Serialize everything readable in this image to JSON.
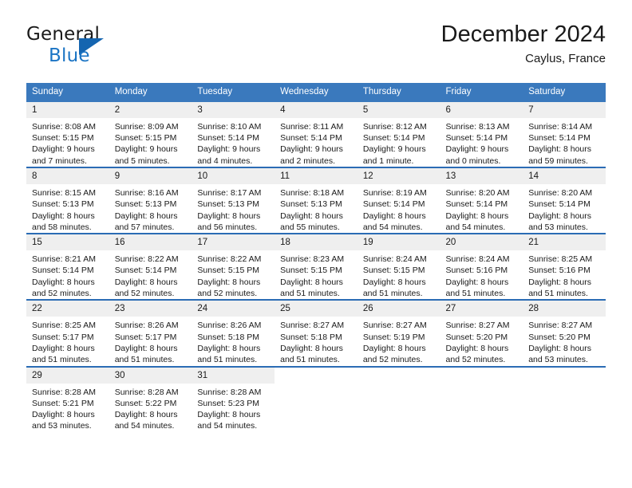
{
  "brand": {
    "name_part1": "General",
    "name_part2": "Blue",
    "triangle_color": "#1565b0",
    "blue_text_color": "#1b74c4"
  },
  "header": {
    "title": "December 2024",
    "subtitle": "Caylus, France"
  },
  "theme": {
    "header_bg": "#3a79bd",
    "row_divider": "#2b6cb5",
    "daynum_bg": "#efefef",
    "text": "#1a1a1a"
  },
  "weekdays": [
    "Sunday",
    "Monday",
    "Tuesday",
    "Wednesday",
    "Thursday",
    "Friday",
    "Saturday"
  ],
  "weeks": [
    [
      {
        "day": "1",
        "sunrise": "Sunrise: 8:08 AM",
        "sunset": "Sunset: 5:15 PM",
        "daylight_line1": "Daylight: 9 hours",
        "daylight_line2": "and 7 minutes."
      },
      {
        "day": "2",
        "sunrise": "Sunrise: 8:09 AM",
        "sunset": "Sunset: 5:15 PM",
        "daylight_line1": "Daylight: 9 hours",
        "daylight_line2": "and 5 minutes."
      },
      {
        "day": "3",
        "sunrise": "Sunrise: 8:10 AM",
        "sunset": "Sunset: 5:14 PM",
        "daylight_line1": "Daylight: 9 hours",
        "daylight_line2": "and 4 minutes."
      },
      {
        "day": "4",
        "sunrise": "Sunrise: 8:11 AM",
        "sunset": "Sunset: 5:14 PM",
        "daylight_line1": "Daylight: 9 hours",
        "daylight_line2": "and 2 minutes."
      },
      {
        "day": "5",
        "sunrise": "Sunrise: 8:12 AM",
        "sunset": "Sunset: 5:14 PM",
        "daylight_line1": "Daylight: 9 hours",
        "daylight_line2": "and 1 minute."
      },
      {
        "day": "6",
        "sunrise": "Sunrise: 8:13 AM",
        "sunset": "Sunset: 5:14 PM",
        "daylight_line1": "Daylight: 9 hours",
        "daylight_line2": "and 0 minutes."
      },
      {
        "day": "7",
        "sunrise": "Sunrise: 8:14 AM",
        "sunset": "Sunset: 5:14 PM",
        "daylight_line1": "Daylight: 8 hours",
        "daylight_line2": "and 59 minutes."
      }
    ],
    [
      {
        "day": "8",
        "sunrise": "Sunrise: 8:15 AM",
        "sunset": "Sunset: 5:13 PM",
        "daylight_line1": "Daylight: 8 hours",
        "daylight_line2": "and 58 minutes."
      },
      {
        "day": "9",
        "sunrise": "Sunrise: 8:16 AM",
        "sunset": "Sunset: 5:13 PM",
        "daylight_line1": "Daylight: 8 hours",
        "daylight_line2": "and 57 minutes."
      },
      {
        "day": "10",
        "sunrise": "Sunrise: 8:17 AM",
        "sunset": "Sunset: 5:13 PM",
        "daylight_line1": "Daylight: 8 hours",
        "daylight_line2": "and 56 minutes."
      },
      {
        "day": "11",
        "sunrise": "Sunrise: 8:18 AM",
        "sunset": "Sunset: 5:13 PM",
        "daylight_line1": "Daylight: 8 hours",
        "daylight_line2": "and 55 minutes."
      },
      {
        "day": "12",
        "sunrise": "Sunrise: 8:19 AM",
        "sunset": "Sunset: 5:14 PM",
        "daylight_line1": "Daylight: 8 hours",
        "daylight_line2": "and 54 minutes."
      },
      {
        "day": "13",
        "sunrise": "Sunrise: 8:20 AM",
        "sunset": "Sunset: 5:14 PM",
        "daylight_line1": "Daylight: 8 hours",
        "daylight_line2": "and 54 minutes."
      },
      {
        "day": "14",
        "sunrise": "Sunrise: 8:20 AM",
        "sunset": "Sunset: 5:14 PM",
        "daylight_line1": "Daylight: 8 hours",
        "daylight_line2": "and 53 minutes."
      }
    ],
    [
      {
        "day": "15",
        "sunrise": "Sunrise: 8:21 AM",
        "sunset": "Sunset: 5:14 PM",
        "daylight_line1": "Daylight: 8 hours",
        "daylight_line2": "and 52 minutes."
      },
      {
        "day": "16",
        "sunrise": "Sunrise: 8:22 AM",
        "sunset": "Sunset: 5:14 PM",
        "daylight_line1": "Daylight: 8 hours",
        "daylight_line2": "and 52 minutes."
      },
      {
        "day": "17",
        "sunrise": "Sunrise: 8:22 AM",
        "sunset": "Sunset: 5:15 PM",
        "daylight_line1": "Daylight: 8 hours",
        "daylight_line2": "and 52 minutes."
      },
      {
        "day": "18",
        "sunrise": "Sunrise: 8:23 AM",
        "sunset": "Sunset: 5:15 PM",
        "daylight_line1": "Daylight: 8 hours",
        "daylight_line2": "and 51 minutes."
      },
      {
        "day": "19",
        "sunrise": "Sunrise: 8:24 AM",
        "sunset": "Sunset: 5:15 PM",
        "daylight_line1": "Daylight: 8 hours",
        "daylight_line2": "and 51 minutes."
      },
      {
        "day": "20",
        "sunrise": "Sunrise: 8:24 AM",
        "sunset": "Sunset: 5:16 PM",
        "daylight_line1": "Daylight: 8 hours",
        "daylight_line2": "and 51 minutes."
      },
      {
        "day": "21",
        "sunrise": "Sunrise: 8:25 AM",
        "sunset": "Sunset: 5:16 PM",
        "daylight_line1": "Daylight: 8 hours",
        "daylight_line2": "and 51 minutes."
      }
    ],
    [
      {
        "day": "22",
        "sunrise": "Sunrise: 8:25 AM",
        "sunset": "Sunset: 5:17 PM",
        "daylight_line1": "Daylight: 8 hours",
        "daylight_line2": "and 51 minutes."
      },
      {
        "day": "23",
        "sunrise": "Sunrise: 8:26 AM",
        "sunset": "Sunset: 5:17 PM",
        "daylight_line1": "Daylight: 8 hours",
        "daylight_line2": "and 51 minutes."
      },
      {
        "day": "24",
        "sunrise": "Sunrise: 8:26 AM",
        "sunset": "Sunset: 5:18 PM",
        "daylight_line1": "Daylight: 8 hours",
        "daylight_line2": "and 51 minutes."
      },
      {
        "day": "25",
        "sunrise": "Sunrise: 8:27 AM",
        "sunset": "Sunset: 5:18 PM",
        "daylight_line1": "Daylight: 8 hours",
        "daylight_line2": "and 51 minutes."
      },
      {
        "day": "26",
        "sunrise": "Sunrise: 8:27 AM",
        "sunset": "Sunset: 5:19 PM",
        "daylight_line1": "Daylight: 8 hours",
        "daylight_line2": "and 52 minutes."
      },
      {
        "day": "27",
        "sunrise": "Sunrise: 8:27 AM",
        "sunset": "Sunset: 5:20 PM",
        "daylight_line1": "Daylight: 8 hours",
        "daylight_line2": "and 52 minutes."
      },
      {
        "day": "28",
        "sunrise": "Sunrise: 8:27 AM",
        "sunset": "Sunset: 5:20 PM",
        "daylight_line1": "Daylight: 8 hours",
        "daylight_line2": "and 53 minutes."
      }
    ],
    [
      {
        "day": "29",
        "sunrise": "Sunrise: 8:28 AM",
        "sunset": "Sunset: 5:21 PM",
        "daylight_line1": "Daylight: 8 hours",
        "daylight_line2": "and 53 minutes."
      },
      {
        "day": "30",
        "sunrise": "Sunrise: 8:28 AM",
        "sunset": "Sunset: 5:22 PM",
        "daylight_line1": "Daylight: 8 hours",
        "daylight_line2": "and 54 minutes."
      },
      {
        "day": "31",
        "sunrise": "Sunrise: 8:28 AM",
        "sunset": "Sunset: 5:23 PM",
        "daylight_line1": "Daylight: 8 hours",
        "daylight_line2": "and 54 minutes."
      },
      {
        "day": "",
        "sunrise": "",
        "sunset": "",
        "daylight_line1": "",
        "daylight_line2": ""
      },
      {
        "day": "",
        "sunrise": "",
        "sunset": "",
        "daylight_line1": "",
        "daylight_line2": ""
      },
      {
        "day": "",
        "sunrise": "",
        "sunset": "",
        "daylight_line1": "",
        "daylight_line2": ""
      },
      {
        "day": "",
        "sunrise": "",
        "sunset": "",
        "daylight_line1": "",
        "daylight_line2": ""
      }
    ]
  ]
}
